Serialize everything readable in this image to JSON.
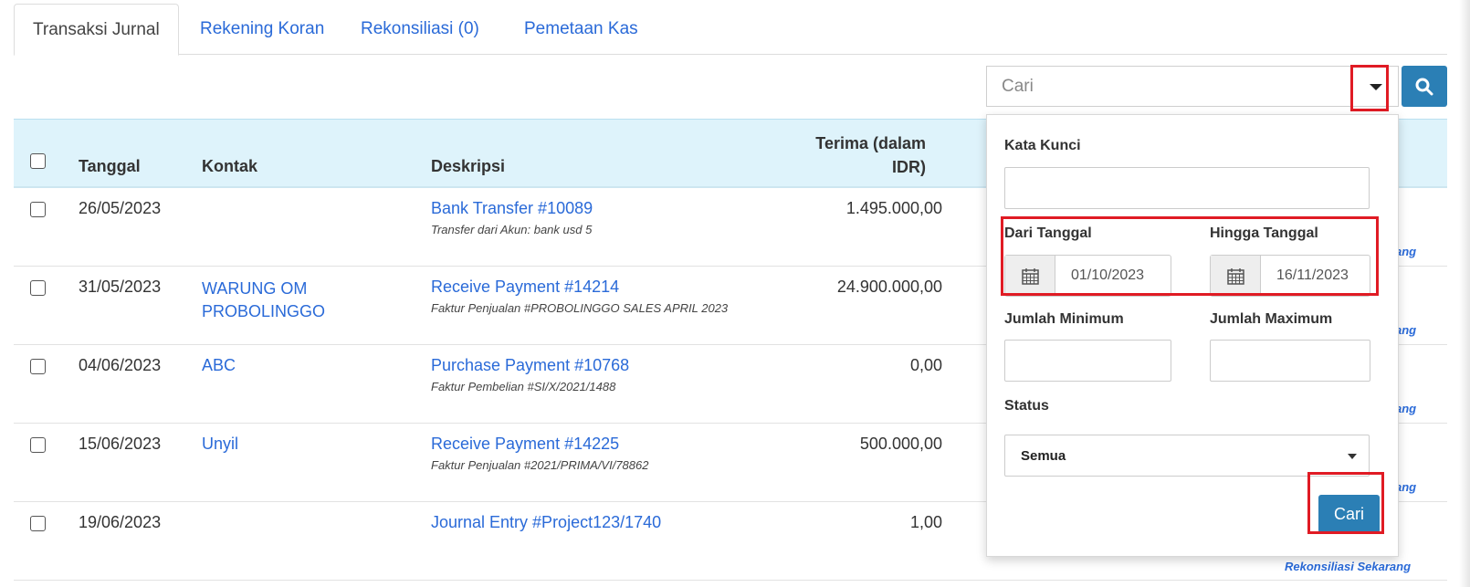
{
  "tabs": [
    {
      "label": "Transaksi Jurnal",
      "active": true
    },
    {
      "label": "Rekening Koran",
      "active": false
    },
    {
      "label": "Rekonsiliasi (0)",
      "active": false
    },
    {
      "label": "Pemetaan Kas",
      "active": false
    }
  ],
  "search": {
    "placeholder": "Cari"
  },
  "table": {
    "headers": {
      "tanggal": "Tanggal",
      "kontak": "Kontak",
      "deskripsi": "Deskripsi",
      "terima_line1": "Terima (dalam",
      "terima_line2": "IDR)"
    },
    "rows": [
      {
        "date": "26/05/2023",
        "contact": "",
        "desc": "Bank Transfer #10089",
        "subdesc": "Transfer dari Akun: bank usd 5",
        "amount": "1.495.000,00",
        "reconcile": "ang"
      },
      {
        "date": "31/05/2023",
        "contact_line1": "WARUNG OM",
        "contact_line2": "PROBOLINGGO",
        "desc": "Receive Payment #14214",
        "subdesc": "Faktur Penjualan #PROBOLINGGO SALES APRIL 2023",
        "amount": "24.900.000,00",
        "reconcile": "ang"
      },
      {
        "date": "04/06/2023",
        "contact": "ABC",
        "desc": "Purchase Payment #10768",
        "subdesc": "Faktur Pembelian #SI/X/2021/1488",
        "amount": "0,00",
        "reconcile": "ang"
      },
      {
        "date": "15/06/2023",
        "contact": "Unyil",
        "desc": "Receive Payment #14225",
        "subdesc": "Faktur Penjualan #2021/PRIMA/VI/78862",
        "amount": "500.000,00",
        "reconcile": "ang"
      },
      {
        "date": "19/06/2023",
        "contact": "",
        "desc": "Journal Entry #Project123/1740",
        "subdesc": "",
        "amount": "1,00",
        "reconcile": "Rekonsiliasi Sekarang"
      }
    ]
  },
  "filter": {
    "keyword_label": "Kata Kunci",
    "keyword_value": "",
    "from_label": "Dari Tanggal",
    "from_value": "01/10/2023",
    "to_label": "Hingga Tanggal",
    "to_value": "16/11/2023",
    "min_label": "Jumlah Minimum",
    "min_value": "",
    "max_label": "Jumlah Maximum",
    "max_value": "",
    "status_label": "Status",
    "status_value": "Semua",
    "submit_label": "Cari"
  },
  "icons": [
    "chevron-down-icon",
    "search-icon",
    "calendar-icon"
  ],
  "colors": {
    "link": "#2a6ad8",
    "primary_button": "#2b7fb5",
    "header_bg": "#def3fb",
    "highlight": "#e01b24"
  }
}
